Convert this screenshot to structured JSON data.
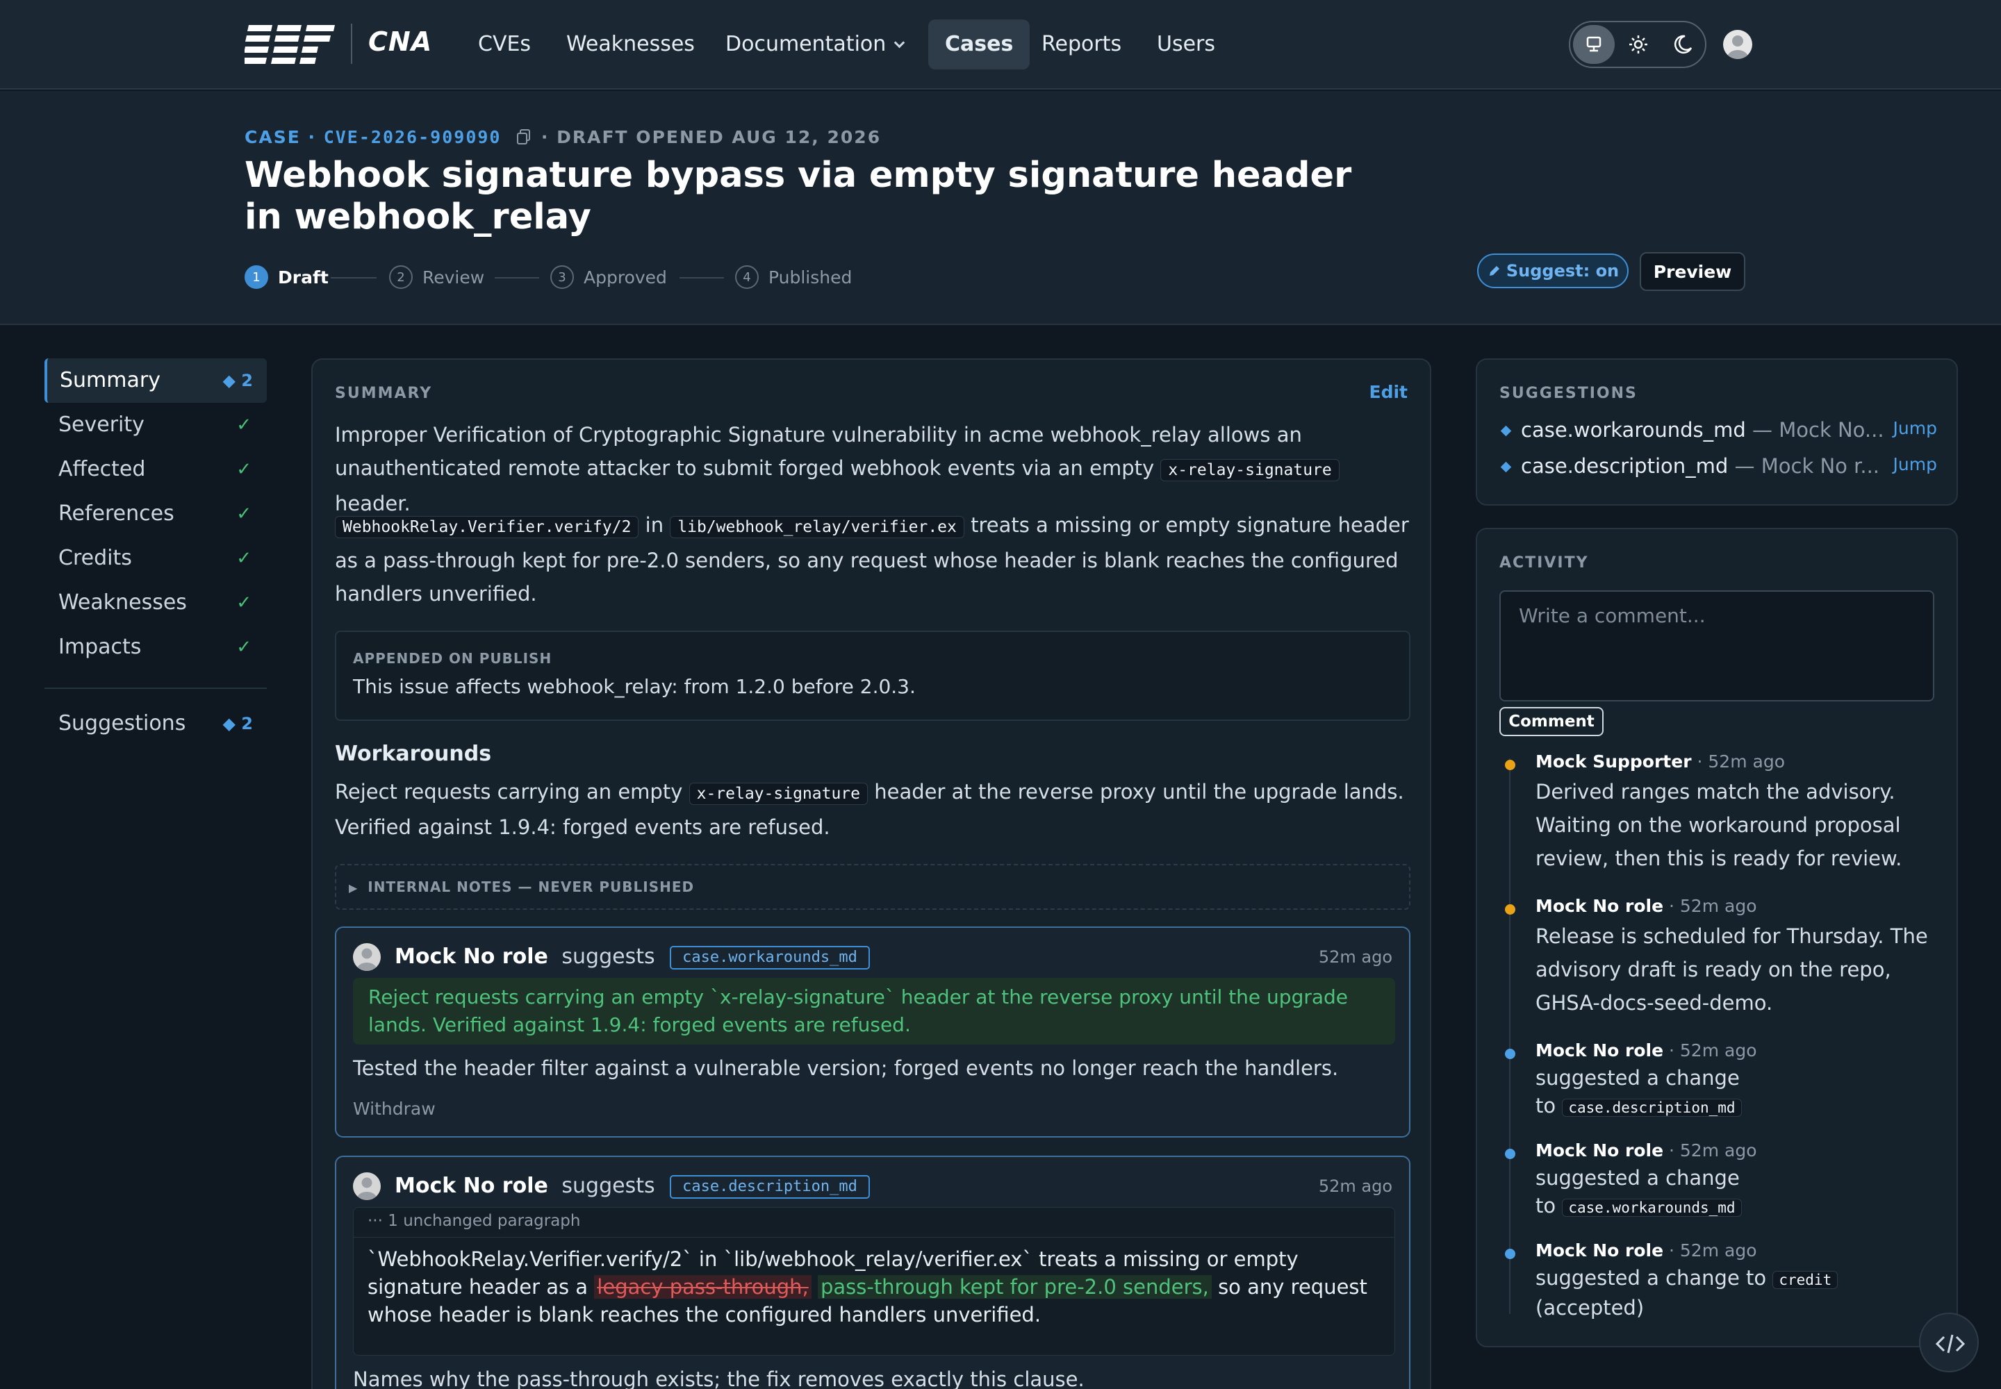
{
  "nav": {
    "logo_text": "CNA",
    "links": [
      "CVEs",
      "Weaknesses",
      "Documentation",
      "Cases",
      "Reports",
      "Users"
    ]
  },
  "case": {
    "crumb_case": "CASE",
    "cve_id": "CVE-2026-909090",
    "status_line": "DRAFT OPENED AUG 12, 2026",
    "title": "Webhook signature bypass via empty signature header in webhook_relay",
    "steps": [
      "Draft",
      "Review",
      "Approved",
      "Published"
    ],
    "step_numbers": [
      "1",
      "2",
      "3",
      "4"
    ],
    "suggest_toggle": "Suggest: on",
    "preview": "Preview"
  },
  "sections": {
    "items": [
      {
        "label": "Summary",
        "badge": "2"
      },
      {
        "label": "Severity",
        "tick": "✓"
      },
      {
        "label": "Affected",
        "tick": "✓"
      },
      {
        "label": "References",
        "tick": "✓"
      },
      {
        "label": "Credits",
        "tick": "✓"
      },
      {
        "label": "Weaknesses",
        "tick": "✓"
      },
      {
        "label": "Impacts",
        "tick": "✓"
      }
    ],
    "suggestions": {
      "label": "Suggestions",
      "badge": "2"
    }
  },
  "summary": {
    "heading": "SUMMARY",
    "edit": "Edit",
    "p1_a": "Improper Verification of Cryptographic Signature vulnerability in acme webhook_relay allows an unauthenticated remote attacker to submit forged webhook events via an empty",
    "p1_code": "x-relay-signature",
    "p1_b": "header.",
    "p2_code1": "WebhookRelay.Verifier.verify/2",
    "p2_in": "in",
    "p2_code2": "lib/webhook_relay/verifier.ex",
    "p2_text": "treats a missing or empty signature header as a pass-through kept for pre-2.0 senders, so any request whose header is blank reaches the configured handlers unverified.",
    "append_label": "APPENDED ON PUBLISH",
    "append_text": "This issue affects webhook_relay: from 1.2.0 before 2.0.3.",
    "workarounds_heading": "Workarounds",
    "work_a": "Reject requests carrying an empty",
    "work_code": "x-relay-signature",
    "work_b": "header at the reverse proxy until the upgrade lands. Verified against 1.9.4: forged events are refused.",
    "internal_notes": "INTERNAL NOTES — NEVER PUBLISHED"
  },
  "suggestion_cards": [
    {
      "author": "Mock No role",
      "verb": "suggests",
      "field": "case.workarounds_md",
      "time": "52m ago",
      "proposed": "Reject requests carrying an empty `x-relay-signature` header at the reverse proxy until the upgrade lands. Verified against 1.9.4: forged events are refused.",
      "note": "Tested the header filter against a vulnerable version; forged events no longer reach the handlers.",
      "withdraw": "Withdraw"
    },
    {
      "author": "Mock No role",
      "verb": "suggests",
      "field": "case.description_md",
      "time": "52m ago",
      "unchanged": "1 unchanged paragraph",
      "diff_a": "`WebhookRelay.Verifier.verify/2` in `lib/webhook_relay/verifier.ex` treats a missing or empty signature header as a",
      "diff_del": "legacy pass-through,",
      "diff_ins": "pass-through kept for pre-2.0 senders,",
      "diff_b": "so any request whose header is blank reaches the configured handlers unverified.",
      "note": "Names why the pass-through exists; the fix removes exactly this clause."
    }
  ],
  "suggestions_panel": {
    "heading": "SUGGESTIONS",
    "rows": [
      {
        "field": "case.workarounds_md",
        "sep": "—",
        "author": "Mock No...",
        "jump": "Jump"
      },
      {
        "field": "case.description_md",
        "sep": "—",
        "author": "Mock No r...",
        "jump": "Jump"
      }
    ]
  },
  "activity": {
    "heading": "ACTIVITY",
    "placeholder": "Write a comment...",
    "comment_button": "Comment",
    "items": [
      {
        "author": "Mock Supporter",
        "time": "· 52m ago",
        "text": "Derived ranges match the advisory. Waiting on the workaround proposal review, then this is ready for review.",
        "color": "#e8a317"
      },
      {
        "author": "Mock No role",
        "time": "· 52m ago",
        "text": "Release is scheduled for Thursday. The advisory draft is ready on the repo, GHSA-docs-seed-demo.",
        "color": "#e8a317"
      },
      {
        "author": "Mock No role",
        "time": "· 52m ago",
        "text_a": "suggested a change",
        "text_b": "to",
        "code": "case.description_md",
        "color": "#4ea0e6"
      },
      {
        "author": "Mock No role",
        "time": "· 52m ago",
        "text_a": "suggested a change",
        "text_b": "to",
        "code": "case.workarounds_md",
        "color": "#4ea0e6"
      },
      {
        "author": "Mock No role",
        "time": "· 52m ago",
        "text_a": "suggested a change to",
        "code": "credit",
        "text_b": "(accepted)",
        "color": "#4ea0e6"
      }
    ]
  }
}
